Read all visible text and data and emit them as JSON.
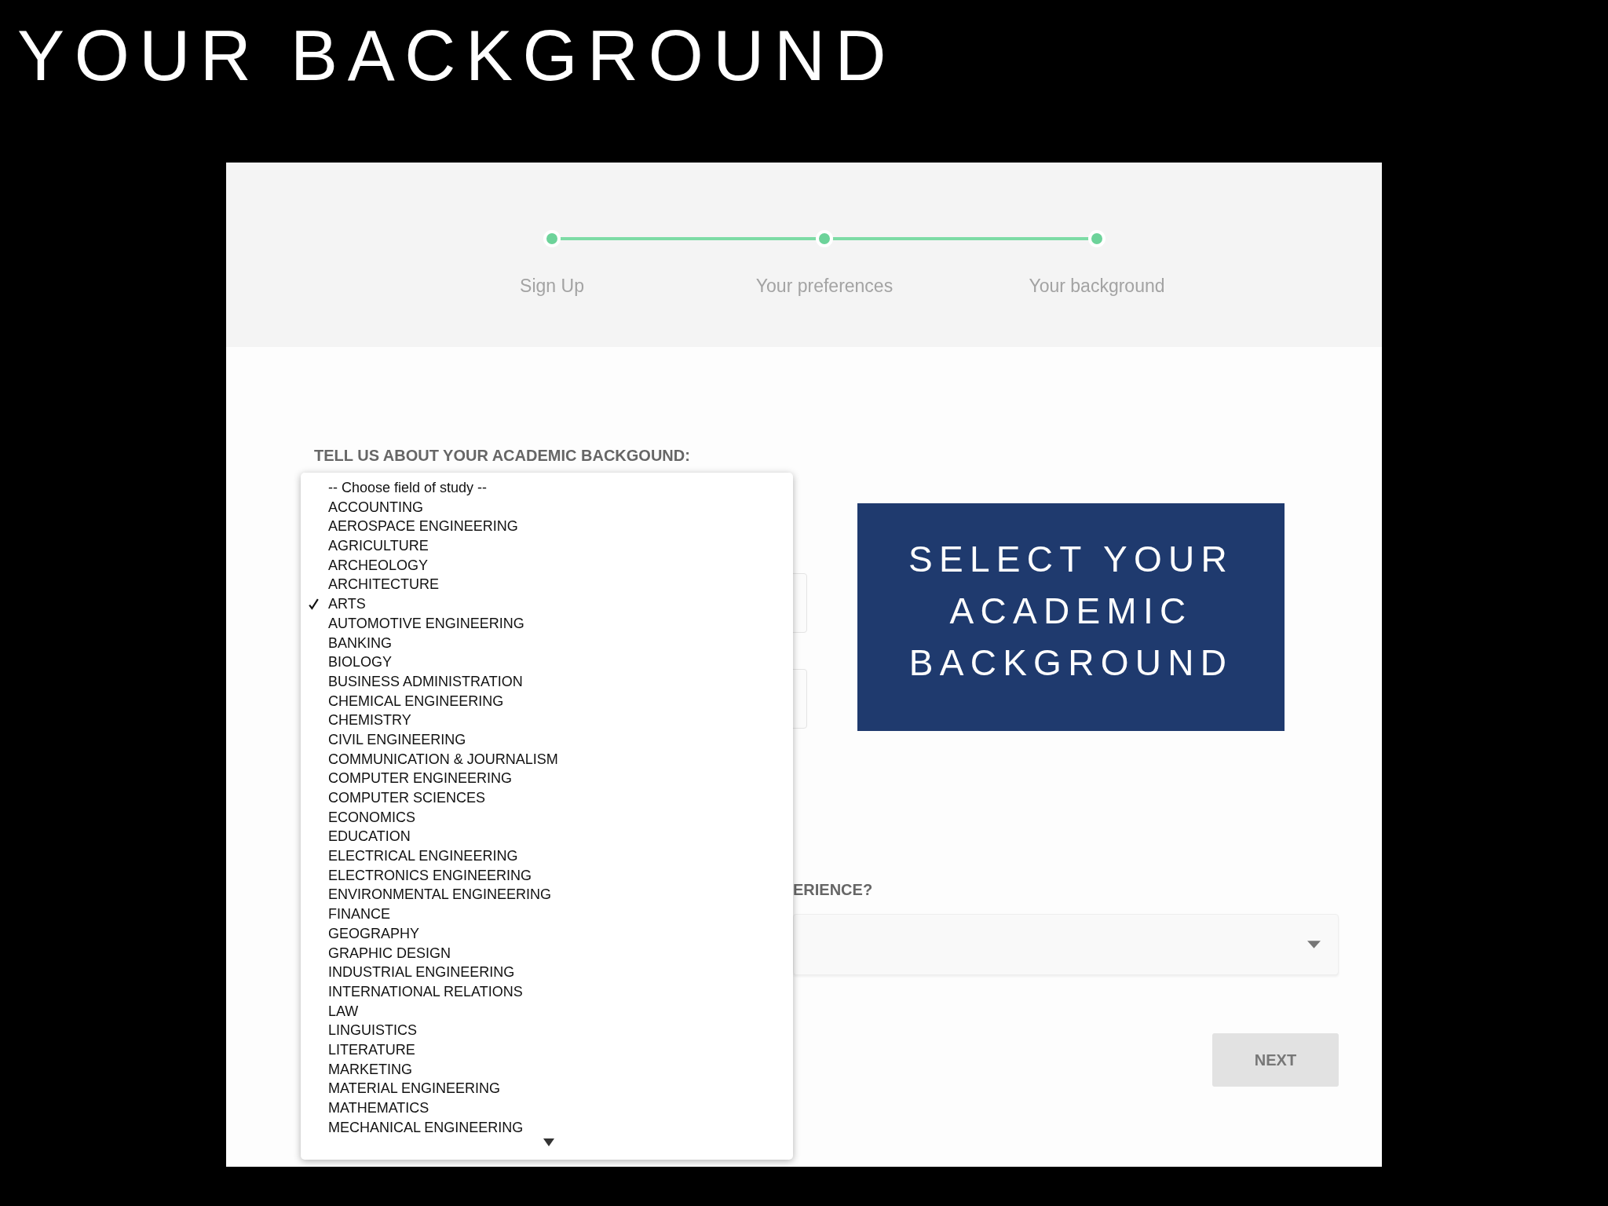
{
  "slide_title": "YOUR BACKGROUND",
  "stepper": {
    "steps": [
      {
        "label": "Sign Up",
        "done": true
      },
      {
        "label": "Your preferences",
        "done": true
      },
      {
        "label": "Your background",
        "done": true
      }
    ]
  },
  "form": {
    "academic_label": "TELL US ABOUT YOUR ACADEMIC BACKGOUND:",
    "field_dropdown": {
      "options": [
        {
          "label": "-- Choose field of study --",
          "selected": false
        },
        {
          "label": "ACCOUNTING",
          "selected": false
        },
        {
          "label": "AEROSPACE ENGINEERING",
          "selected": false
        },
        {
          "label": "AGRICULTURE",
          "selected": false
        },
        {
          "label": "ARCHEOLOGY",
          "selected": false
        },
        {
          "label": "ARCHITECTURE",
          "selected": false
        },
        {
          "label": "ARTS",
          "selected": true
        },
        {
          "label": "AUTOMOTIVE ENGINEERING",
          "selected": false
        },
        {
          "label": "BANKING",
          "selected": false
        },
        {
          "label": "BIOLOGY",
          "selected": false
        },
        {
          "label": "BUSINESS ADMINISTRATION",
          "selected": false
        },
        {
          "label": "CHEMICAL ENGINEERING",
          "selected": false
        },
        {
          "label": "CHEMISTRY",
          "selected": false
        },
        {
          "label": "CIVIL ENGINEERING",
          "selected": false
        },
        {
          "label": "COMMUNICATION & JOURNALISM",
          "selected": false
        },
        {
          "label": "COMPUTER ENGINEERING",
          "selected": false
        },
        {
          "label": "COMPUTER SCIENCES",
          "selected": false
        },
        {
          "label": "ECONOMICS",
          "selected": false
        },
        {
          "label": "EDUCATION",
          "selected": false
        },
        {
          "label": "ELECTRICAL ENGINEERING",
          "selected": false
        },
        {
          "label": "ELECTRONICS ENGINEERING",
          "selected": false
        },
        {
          "label": "ENVIRONMENTAL ENGINEERING",
          "selected": false
        },
        {
          "label": "FINANCE",
          "selected": false
        },
        {
          "label": "GEOGRAPHY",
          "selected": false
        },
        {
          "label": "GRAPHIC DESIGN",
          "selected": false
        },
        {
          "label": "INDUSTRIAL ENGINEERING",
          "selected": false
        },
        {
          "label": "INTERNATIONAL RELATIONS",
          "selected": false
        },
        {
          "label": "LAW",
          "selected": false
        },
        {
          "label": "LINGUISTICS",
          "selected": false
        },
        {
          "label": "LITERATURE",
          "selected": false
        },
        {
          "label": "MARKETING",
          "selected": false
        },
        {
          "label": "MATERIAL ENGINEERING",
          "selected": false
        },
        {
          "label": "MATHEMATICS",
          "selected": false
        },
        {
          "label": "MECHANICAL ENGINEERING",
          "selected": false
        }
      ]
    },
    "experience_label": "ERIENCE?",
    "next_button": "NEXT"
  },
  "callout": {
    "lines": [
      "SELECT YOUR",
      "ACADEMIC",
      "BACKGROUND"
    ]
  }
}
